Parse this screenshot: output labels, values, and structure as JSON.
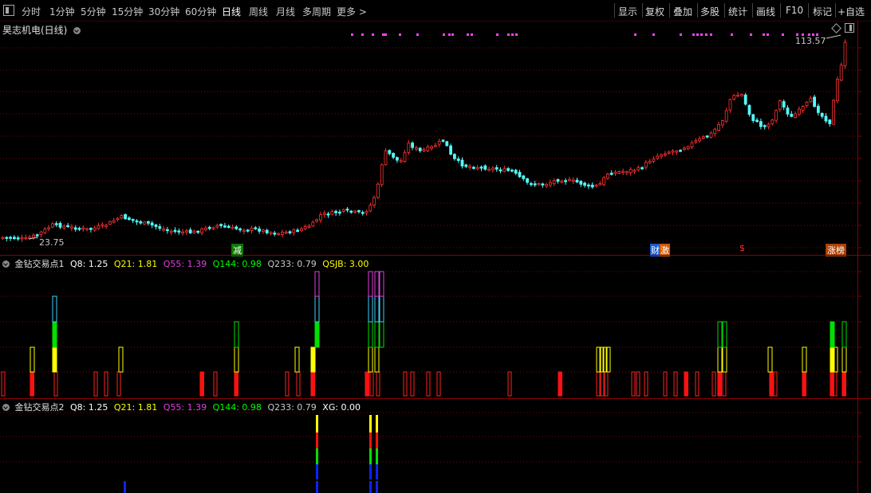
{
  "toolbar": {
    "periods": [
      "分时",
      "1分钟",
      "5分钟",
      "15分钟",
      "30分钟",
      "60分钟",
      "日线",
      "周线",
      "月线",
      "多周期"
    ],
    "more": "更多",
    "active_period": "日线",
    "right_buttons": [
      "显示",
      "复权",
      "叠加",
      "多股",
      "统计",
      "画线",
      "F10",
      "标记",
      "+自选"
    ]
  },
  "main_chart": {
    "stock_title": "昊志机电(日线)",
    "high_label": "113.57",
    "low_label": "23.75",
    "event_tags": [
      "减",
      "财",
      "激",
      "$",
      "涨榜"
    ]
  },
  "indicator1": {
    "name": "金钻交易点1",
    "values": [
      {
        "label": "Q8: 1.25",
        "color": "#ffffff"
      },
      {
        "label": "Q21: 1.81",
        "color": "#ffff00"
      },
      {
        "label": "Q55: 1.39",
        "color": "#e040e0"
      },
      {
        "label": "Q144: 0.98",
        "color": "#00ff00"
      },
      {
        "label": "Q233: 0.79",
        "color": "#c8c8c8"
      },
      {
        "label": "QSJB: 3.00",
        "color": "#ffff00"
      }
    ]
  },
  "indicator2": {
    "name": "金钻交易点2",
    "values": [
      {
        "label": "Q8: 1.25",
        "color": "#ffffff"
      },
      {
        "label": "Q21: 1.81",
        "color": "#ffff00"
      },
      {
        "label": "Q55: 1.39",
        "color": "#e040e0"
      },
      {
        "label": "Q144: 0.98",
        "color": "#00ff00"
      },
      {
        "label": "Q233: 0.79",
        "color": "#c8c8c8"
      },
      {
        "label": "XG: 0.00",
        "color": "#ffffff"
      }
    ]
  },
  "colors": {
    "up": "#ff3232",
    "down": "#54fcfc",
    "grid": "#8a0000",
    "magenta": "#ff40ff"
  }
}
